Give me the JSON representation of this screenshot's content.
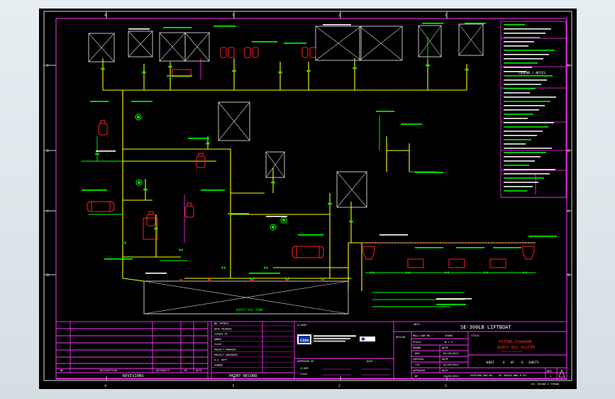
{
  "drawing": {
    "ship": "SE-300LB LIFTBOAT",
    "title_lines": [
      "PIPING DIAGRAM",
      "DIRTY OIL SYSTEM"
    ],
    "sheet_label": "SHEET",
    "sheet_no": "6",
    "of_label": "OF",
    "sheet_total": "6",
    "sheets_label": "SHEETS",
    "rev_label": "REV.",
    "rev": "1",
    "paper": "A1: 841mm x 594mm",
    "drawing_no_label": "SHIPYARD DWG NO.",
    "drawing_no": "SE-300LB-DWG-P-03"
  },
  "title_block": {
    "client_label": "CLIENT:",
    "unit_label": "UNIT:",
    "title_label": "TITLE:",
    "hull_label": "HULL/JOB NO.:",
    "hull": "43003",
    "scale_label": "SCALE:",
    "scale": "N.T.S",
    "drawn_label": "DRAWN",
    "drawn": "DKD",
    "checked_label": "CHECKED",
    "checked": "TJR",
    "approved_label": "APPROVED",
    "approved": "WF",
    "date_label": "DATE",
    "dates": [
      "02/09/2013",
      "02/09/2013",
      "25/09/2013"
    ],
    "approved_by_label": "APPROVED BY",
    "date2_label": "DATE :",
    "class_label": "CLASS",
    "client_sig_label": "CLIENT",
    "logo_text": "CSSC",
    "design_label": "DESIGN"
  },
  "revisions": {
    "title": "REVISIONS",
    "cols": [
      "NO",
      "DESCRIPTION",
      "AUTHORITY",
      "BY",
      "DATE"
    ]
  },
  "print_record": {
    "title": "PRINT RECORD",
    "rows": [
      "NO. PRINTS",
      "DATE PRINTED",
      "ISSUED TO",
      "OWNER",
      "CLASS",
      "PROJECT MANAGER",
      "PROJECT ENGINEER",
      "Q.A. DEPT",
      "VENDOR"
    ]
  },
  "notes": {
    "sump_label": "DIRTY OIL TANK",
    "legend_heading": "LEGEND / NOTES"
  }
}
